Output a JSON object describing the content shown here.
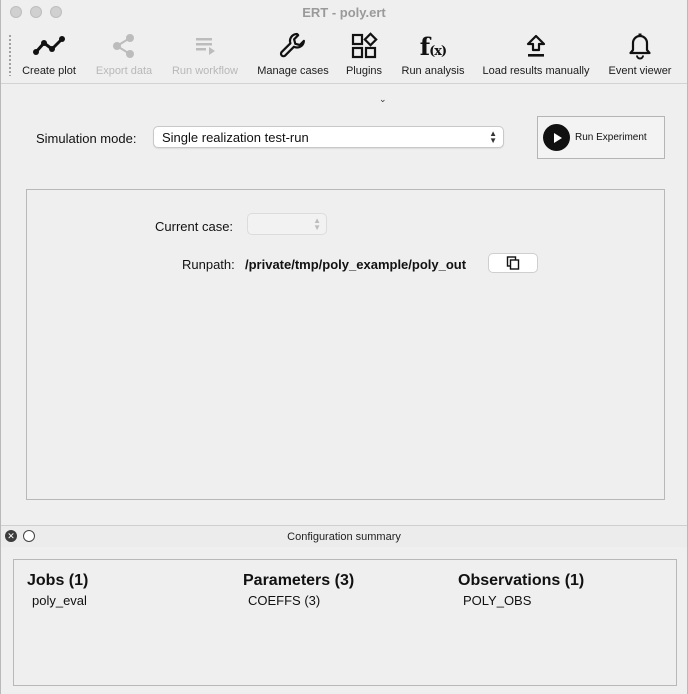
{
  "window": {
    "title": "ERT - poly.ert"
  },
  "toolbar": {
    "items": [
      {
        "label": "Create plot",
        "icon": "line-chart-icon",
        "enabled": true
      },
      {
        "label": "Export data",
        "icon": "share-icon",
        "enabled": false
      },
      {
        "label": "Run workflow",
        "icon": "workflow-icon",
        "enabled": false
      },
      {
        "label": "Manage cases",
        "icon": "wrench-icon",
        "enabled": true
      },
      {
        "label": "Plugins",
        "icon": "widgets-icon",
        "enabled": true,
        "has_menu": true
      },
      {
        "label": "Run analysis",
        "icon": "function-icon",
        "enabled": true
      },
      {
        "label": "Load results manually",
        "icon": "upload-icon",
        "enabled": true
      },
      {
        "label": "Event viewer",
        "icon": "bell-icon",
        "enabled": true
      }
    ]
  },
  "simulation": {
    "mode_label": "Simulation mode:",
    "mode_value": "Single realization test-run",
    "run_button": "Run Experiment"
  },
  "panel": {
    "current_case_label": "Current case:",
    "current_case_value": "",
    "runpath_label": "Runpath:",
    "runpath_value": "/private/tmp/poly_example/poly_out"
  },
  "summary": {
    "title": "Configuration summary",
    "columns": [
      {
        "heading": "Jobs (1)",
        "items": [
          "poly_eval"
        ]
      },
      {
        "heading": "Parameters (3)",
        "items": [
          "COEFFS (3)"
        ]
      },
      {
        "heading": "Observations (1)",
        "items": [
          "POLY_OBS"
        ]
      }
    ]
  },
  "colors": {
    "accent": "#111111",
    "disabled": "#b8b8b8",
    "background": "#efefef"
  }
}
